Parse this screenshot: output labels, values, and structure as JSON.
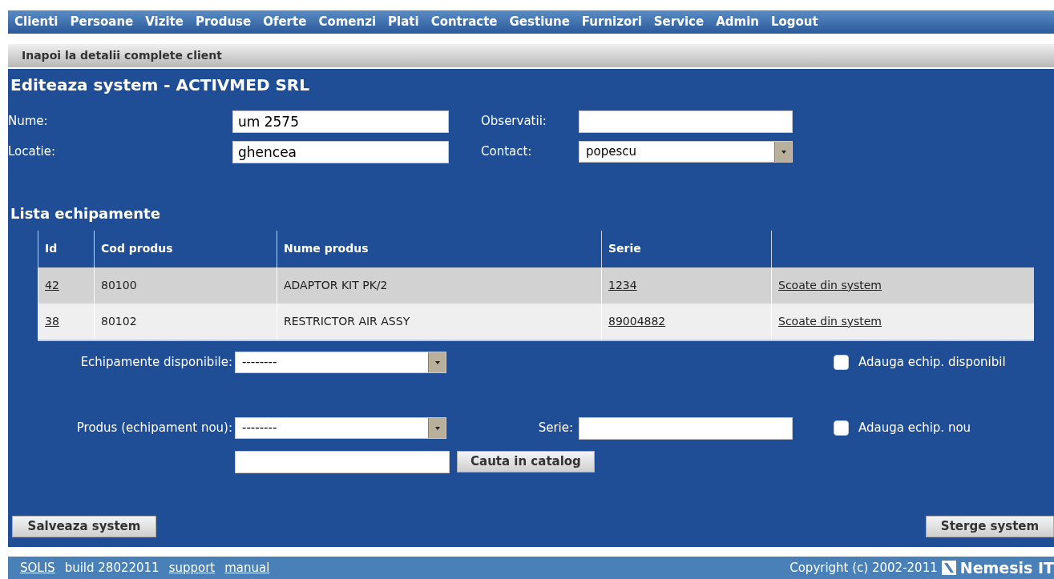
{
  "nav": {
    "items": [
      "Clienti",
      "Persoane",
      "Vizite",
      "Produse",
      "Oferte",
      "Comenzi",
      "Plati",
      "Contracte",
      "Gestiune",
      "Furnizori",
      "Service",
      "Admin",
      "Logout"
    ]
  },
  "back_link": "Inapoi la detalii complete client",
  "title": "Editeaza system - ACTIVMED SRL",
  "fields": [
    {
      "label": "Nume:",
      "value": "um 2575",
      "kind": "text"
    },
    {
      "label": "Observatii:",
      "kind": "text"
    },
    {
      "label": "Locatie:",
      "value": "ghencea",
      "kind": "text"
    },
    {
      "label": "Contact:",
      "value": "popescu",
      "kind": "select"
    }
  ],
  "equipment": {
    "title": "Lista echipamente",
    "columns": [
      "Id",
      "Cod produs",
      "Nume produs",
      "Serie"
    ],
    "rows": [
      {
        "id": "42",
        "code": "80100",
        "name": "ADAPTOR KIT PK/2",
        "serie": "1234",
        "action": "Scoate din system"
      },
      {
        "id": "38",
        "code": "80102",
        "name": "RESTRICTOR AIR ASSY",
        "serie": "89004882",
        "action": "Scoate din system"
      }
    ]
  },
  "available": {
    "label": "Echipamente disponibile:",
    "value": "--------",
    "checkbox": {
      "label": "Adauga echip. disponibil",
      "checked": false
    }
  },
  "new_item": {
    "label": "Produs (echipament nou):",
    "value": "--------",
    "serie_label": "Serie:",
    "checkbox": {
      "label": "Adauga echip. nou",
      "checked": false
    },
    "search_button": "Cauta in catalog"
  },
  "buttons": {
    "save": "Salveaza system",
    "delete": "Sterge system"
  },
  "footer": {
    "app": "SOLIS",
    "build": "build 28022011",
    "links": [
      "support",
      "manual"
    ],
    "copyright": "Copyright (c) 2002-2011",
    "brand": "Nemesis IT"
  }
}
